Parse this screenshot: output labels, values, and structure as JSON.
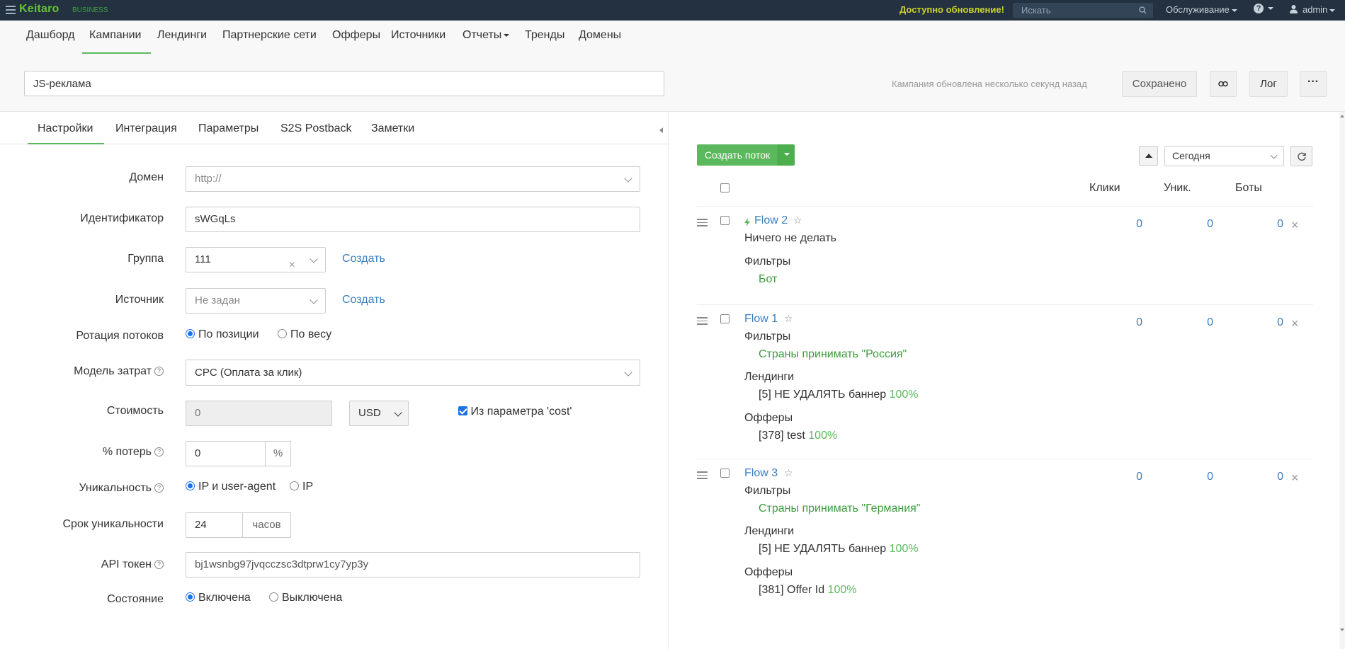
{
  "topbar": {
    "logo": "Keitaro",
    "edition": "BUSINESS",
    "update_notice": "Доступно обновление!",
    "search_placeholder": "Искать",
    "maintenance": "Обслуживание",
    "user": "admin"
  },
  "nav": {
    "items": [
      "Дашборд",
      "Кампании",
      "Лендинги",
      "Партнерские сети",
      "Офферы",
      "Источники",
      "Отчеты",
      "Тренды",
      "Домены"
    ],
    "active": "Кампании"
  },
  "header": {
    "campaign_name": "JS-реклама",
    "updated_text": "Кампания обновлена несколько секунд назад",
    "saved_label": "Сохранено",
    "log_label": "Лог",
    "more_label": "···"
  },
  "tabs": {
    "items": [
      "Настройки",
      "Интеграция",
      "Параметры",
      "S2S Postback",
      "Заметки"
    ],
    "active": "Настройки"
  },
  "settings": {
    "domain": {
      "label": "Домен",
      "value": "http://"
    },
    "identifier": {
      "label": "Идентификатор",
      "value": "sWGqLs"
    },
    "group": {
      "label": "Группа",
      "value": "111",
      "create": "Создать"
    },
    "source": {
      "label": "Источник",
      "value": "Не задан",
      "create": "Создать"
    },
    "rotation": {
      "label": "Ротация потоков",
      "opt1": "По позиции",
      "opt2": "По весу",
      "selected": "По позиции"
    },
    "cost_model": {
      "label": "Модель затрат",
      "value": "CPC (Оплата за клик)"
    },
    "cost": {
      "label": "Стоимость",
      "value": "0",
      "currency": "USD",
      "from_param": "Из параметра 'cost'",
      "from_param_checked": true
    },
    "loss": {
      "label": "% потерь",
      "value": "0",
      "unit": "%"
    },
    "uniqueness": {
      "label": "Уникальность",
      "opt1": "IP и user-agent",
      "opt2": "IP",
      "selected": "IP и user-agent"
    },
    "uniq_period": {
      "label": "Срок уникальности",
      "value": "24",
      "unit": "часов"
    },
    "api_token": {
      "label": "API токен",
      "value": "bj1wsnbg97jvqcczsc3dtprw1cy7yp3y"
    },
    "state": {
      "label": "Состояние",
      "opt1": "Включена",
      "opt2": "Выключена",
      "selected": "Включена"
    }
  },
  "flows_panel": {
    "create_label": "Создать поток",
    "period": "Сегодня",
    "columns": [
      "Клики",
      "Уник.",
      "Боты"
    ],
    "flows": [
      {
        "name": "Flow 2",
        "action": "Ничего не делать",
        "filters_label": "Фильтры",
        "filters": "Бот",
        "clicks": "0",
        "uniques": "0",
        "bots": "0"
      },
      {
        "name": "Flow 1",
        "filters_label": "Фильтры",
        "filters": "Страны принимать \"Россия\"",
        "landings_label": "Лендинги",
        "landing": "[5] НЕ УДАЛЯТЬ баннер",
        "landing_pct": "100%",
        "offers_label": "Офферы",
        "offer": "[378] test",
        "offer_pct": "100%",
        "clicks": "0",
        "uniques": "0",
        "bots": "0"
      },
      {
        "name": "Flow 3",
        "filters_label": "Фильтры",
        "filters": "Страны принимать \"Германия\"",
        "landings_label": "Лендинги",
        "landing": "[5] НЕ УДАЛЯТЬ баннер",
        "landing_pct": "100%",
        "offers_label": "Офферы",
        "offer": "[381] Offer Id",
        "offer_pct": "100%",
        "clicks": "0",
        "uniques": "0",
        "bots": "0"
      }
    ]
  },
  "colors": {
    "topbar": "#233140",
    "accent_green": "#5cb85c",
    "link_blue": "#3a7ebf",
    "update_yellow": "#cdd32e"
  }
}
